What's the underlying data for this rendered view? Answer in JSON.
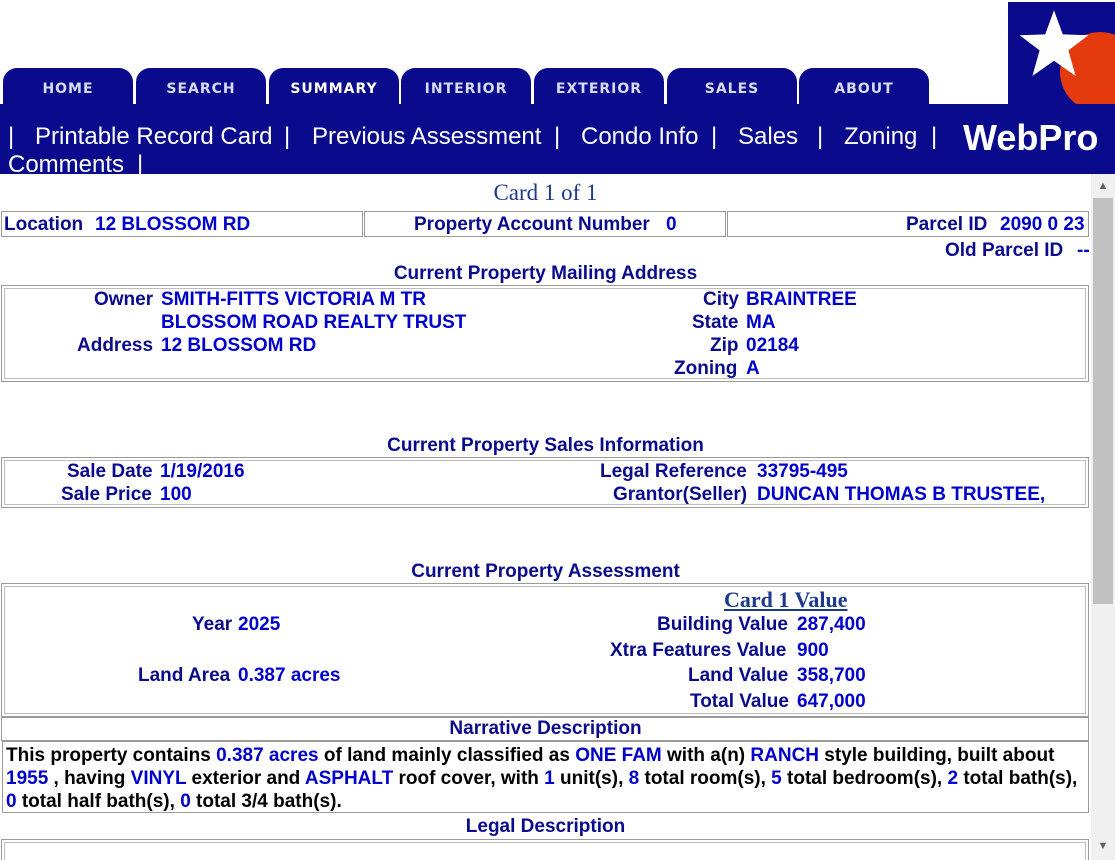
{
  "nav": {
    "tabs": [
      {
        "label": "HOME"
      },
      {
        "label": "SEARCH"
      },
      {
        "label": "SUMMARY",
        "active": true
      },
      {
        "label": "INTERIOR"
      },
      {
        "label": "EXTERIOR"
      },
      {
        "label": "SALES"
      },
      {
        "label": "ABOUT"
      }
    ]
  },
  "links": {
    "sep": "|",
    "items": [
      "Printable Record Card",
      "Previous Assessment",
      "Condo Info",
      "Sales",
      "Zoning",
      "Comments"
    ],
    "brand": "WebPro"
  },
  "card": {
    "label": "Card 1 of 1"
  },
  "parcel": {
    "location_label": "Location",
    "location": "12 BLOSSOM RD",
    "account_label": "Property Account Number",
    "account": "0",
    "parcel_id_label": "Parcel ID",
    "parcel_id": "2090 0 23",
    "old_parcel_label": "Old Parcel ID",
    "old_parcel": "--"
  },
  "mailing": {
    "heading": "Current Property Mailing Address",
    "owner_label": "Owner",
    "owner_line1": "SMITH-FITTS VICTORIA M TR",
    "owner_line2": "BLOSSOM ROAD REALTY TRUST",
    "address_label": "Address",
    "address": "12 BLOSSOM RD",
    "city_label": "City",
    "city": "BRAINTREE",
    "state_label": "State",
    "state": "MA",
    "zip_label": "Zip",
    "zip": "02184",
    "zoning_label": "Zoning",
    "zoning": "A"
  },
  "sales": {
    "heading": "Current Property Sales Information",
    "date_label": "Sale Date",
    "date": "1/19/2016",
    "price_label": "Sale Price",
    "price": "100",
    "legal_label": "Legal Reference",
    "legal": "33795-495",
    "grantor_label": "Grantor(Seller)",
    "grantor": "DUNCAN THOMAS B TRUSTEE,"
  },
  "assessment": {
    "heading": "Current Property Assessment",
    "card_value_label": "Card 1 Value",
    "year_label": "Year",
    "year": "2025",
    "land_area_label": "Land Area",
    "land_area": "0.387 acres",
    "building_label": "Building Value",
    "building": "287,400",
    "xtra_label": "Xtra Features Value",
    "xtra": "900",
    "land_value_label": "Land Value",
    "land_value": "358,700",
    "total_label": "Total Value",
    "total": "647,000"
  },
  "narrative": {
    "heading": "Narrative Description",
    "t1": "This property contains ",
    "acres": "0.387 acres",
    "t2": " of land mainly classified as ",
    "class": "ONE FAM",
    "t3": " with a(n) ",
    "style": "RANCH",
    "t4": " style building, built about ",
    "year": "1955",
    "t5": " , having ",
    "exterior": "VINYL",
    "t6": " exterior and ",
    "roof": "ASPHALT",
    "t7": " roof cover, with ",
    "units": "1",
    "t8": " unit(s), ",
    "rooms": "8",
    "t9": " total room(s), ",
    "bedrooms": "5",
    "t10": " total bedroom(s), ",
    "baths": "2",
    "t11": " total bath(s), ",
    "half_baths": "0",
    "t12": " total half bath(s), ",
    "three_quarter_baths": "0",
    "t13": " total 3/4 bath(s)."
  },
  "legal": {
    "heading": "Legal Description"
  },
  "colors": {
    "nav_blue": "#0a0a8c",
    "value_blue": "#0000cc",
    "logo_red": "#e43a0e"
  }
}
